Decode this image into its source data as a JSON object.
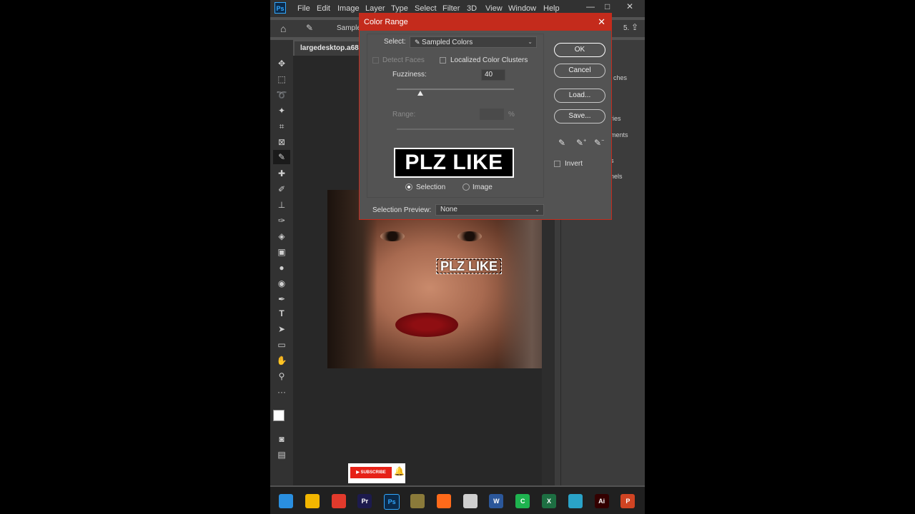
{
  "app": {
    "logo": "Ps",
    "menu": [
      "File",
      "Edit",
      "Image",
      "Layer",
      "Type",
      "Select",
      "Filter",
      "3D",
      "View",
      "Window",
      "Help"
    ],
    "window_controls": [
      "—",
      "□",
      "✕"
    ]
  },
  "options_bar": {
    "sample_label": "Sample",
    "right_text": "5."
  },
  "document": {
    "tab_name": "largedesktop.a68",
    "selection_text": "PLZ LIKE"
  },
  "right_panel": {
    "labels": [
      "ches",
      "ries",
      "ments",
      "s",
      "nels"
    ]
  },
  "dialog": {
    "title": "Color Range",
    "close": "✕",
    "select_label": "Select:",
    "select_value": "Sampled Colors",
    "detect_faces": "Detect Faces",
    "localized_clusters": "Localized Color Clusters",
    "fuzziness_label": "Fuzziness:",
    "fuzziness_value": "40",
    "fuzziness_fraction": 0.2,
    "range_label": "Range:",
    "range_unit": "%",
    "preview_text": "PLZ LIKE",
    "radio_selection": "Selection",
    "radio_image": "Image",
    "selected_radio": "Selection",
    "preview_mode_label": "Selection Preview:",
    "preview_mode_value": "None",
    "buttons": {
      "ok": "OK",
      "cancel": "Cancel",
      "load": "Load...",
      "save": "Save..."
    },
    "invert_label": "Invert",
    "accent_color": "#c42b1c"
  },
  "subscribe_badge": {
    "label": "SUBSCRIBE"
  },
  "taskbar": {
    "apps": [
      {
        "name": "windows-start-icon",
        "text": "",
        "color": "#2a8fe0"
      },
      {
        "name": "file-explorer-icon",
        "text": "",
        "color": "#f2b600"
      },
      {
        "name": "chrome-icon",
        "text": "",
        "color": "#e23a2c"
      },
      {
        "name": "premiere-icon",
        "text": "Pr",
        "color": "#1c1a4d"
      },
      {
        "name": "photoshop-icon",
        "text": "Ps",
        "color": "#0b2a4a"
      },
      {
        "name": "globe-icon",
        "text": "",
        "color": "#8a7a3a"
      },
      {
        "name": "firefox-icon",
        "text": "",
        "color": "#ff6a1a"
      },
      {
        "name": "snipping-tool-icon",
        "text": "",
        "color": "#cfcfcf"
      },
      {
        "name": "word-icon",
        "text": "W",
        "color": "#2b579a"
      },
      {
        "name": "camtasia-icon",
        "text": "C",
        "color": "#1eb34f"
      },
      {
        "name": "excel-icon",
        "text": "X",
        "color": "#1d6f42"
      },
      {
        "name": "remote-desktop-icon",
        "text": "",
        "color": "#2aa3c8"
      },
      {
        "name": "illustrator-icon",
        "text": "Ai",
        "color": "#330000"
      },
      {
        "name": "powerpoint-icon",
        "text": "P",
        "color": "#d04423"
      }
    ]
  }
}
